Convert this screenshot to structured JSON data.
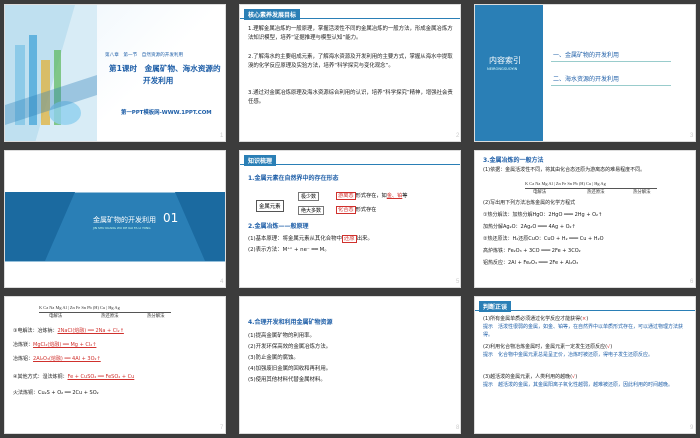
{
  "slides": [
    {
      "page": "1",
      "chapter": "第八章　第一节　自然资源的开发利用",
      "title_line1": "第1课时　金属矿物、海水资源的",
      "title_line2": "开发利用",
      "website": "第一PPT模板网-WWW.1PPT.COM"
    },
    {
      "page": "2",
      "tag": "核心素养发展目标",
      "goal1": "1.理解金属冶炼的一般原理，掌握活泼性不同的金属冶炼的一般方法，形成金属冶炼方法知识模型，培养“证据推理与模型认知”能力。",
      "goal2": "2.了解海水的主要组成元素，了解海水资源及开发利用的主要方式，掌握从海水中提取溴的化学反应原理及实验方法，培养“科学探究与变化观念”。",
      "goal3": "3.通过对金属冶炼原理及海水资源综合利用的认识，培养“科学探究”精神，增强社会责任感。"
    },
    {
      "page": "3",
      "index_title": "内容索引",
      "index_sub": "NEIRONGSUOYIN",
      "item1": "一、金属矿物的开发利用",
      "item2": "二、海水资源的开发利用"
    },
    {
      "page": "4",
      "section_cn": "金属矿物的开发利用",
      "section_en": "JIN SHU KUANG WU DE KAI FA LI YONG",
      "section_num": "01"
    },
    {
      "page": "5",
      "tag": "知识梳理",
      "h1": "1.金属元素在自然界中的存在形态",
      "node_center": "金属元素",
      "node_a": "极少数",
      "node_b": "绝大多数",
      "state_free": "游离态",
      "free_suffix": "形式存在，如",
      "examples": "金、铂",
      "eq_suffix": "等",
      "state_combined": "化合态",
      "combined_suffix": "形式存在",
      "h2": "2.金属冶炼——般原理",
      "p1": "(1)基本原理：将金属元素从其化合物中",
      "p1_key": "还原",
      "p1_tail": "出来。",
      "p2": "(2)表示方法：M⁺ⁿ + ne⁻ ══ M。"
    },
    {
      "page": "6",
      "h": "3.金属冶炼的一般方法",
      "l1": "(1)依据：金属活泼性不同，将其由化合态还原为游离态的难易程度不同。",
      "series": "K Ca Na Mg Al | Zn Fe Sn Pb (H) Cu | Hg Ag",
      "m1": "电解法",
      "m2": "热还原法",
      "m3": "热分解法",
      "l2": "(2)写出用下列方法冶炼金属的化学方程式",
      "l3": "①热分解法：加热分解HgO：2HgO ═══ 2Hg + O₂↑",
      "l4": "加热分解Ag₂O：2Ag₂O ═══ 4Ag + O₂↑",
      "l5": "②热还原法：H₂还原CuO：CuO + H₂ ═══ Cu + H₂O",
      "l6": "高炉炼铁：Fe₂O₃ + 3CO ═══ 2Fe + 3CO₂",
      "l7": "铝热反应：2Al + Fe₂O₃ ═══ 2Fe + Al₂O₃"
    },
    {
      "page": "7",
      "series": "K Ca Na Mg Al | Zn Fe Sn Pb (H) Cu | Hg Ag",
      "m1": "电解法",
      "m2": "热还原法",
      "m3": "热分解法",
      "l1": "③电解法：冶炼钠：",
      "r1": "2NaCl(熔融) ══ 2Na + Cl₂↑",
      "l2": "冶炼镁：",
      "r2": "MgCl₂(熔融) ══ Mg + Cl₂↑",
      "l3": "冶炼铝：",
      "r3": "2Al₂O₃(熔融) ══ 4Al + 3O₂↑",
      "l4": "④其他方式：湿法炼铜：",
      "r4": "Fe + CuSO₄ ══ FeSO₄ + Cu",
      "l5": "火法炼铜：Cu₂S + O₂ ══ 2Cu + SO₂"
    },
    {
      "page": "8",
      "h": "4.合理开发和利用金属矿物资源",
      "i1": "(1)提高金属矿物的利用率。",
      "i2": "(2)开发环保高效的金属冶炼方法。",
      "i3": "(3)防止金属的腐蚀。",
      "i4": "(4)加强废旧金属的回收和再利用。",
      "i5": "(5)使用其他材料代替金属材料。"
    },
    {
      "page": "9",
      "tag": "判断正误",
      "q1": "(1)所有金属单质必须通过化学反应才能获得(",
      "a1": "×",
      "t1": "提示　活泼性很弱的金属，如金、铂等，在自然界中以单质形式存在，可以通过物理方法获得。",
      "q2": "(2)利用化合物冶炼金属时，金属元素一定发生还原反应(",
      "a2": "√",
      "t2": "提示　化合物中金属元素总是呈正价，冶炼时被还原，得电子发生还原反应。",
      "q3": "(3)越活泼的金属元素，人类利用的越晚(",
      "a3": "√",
      "t3": "提示　越活泼的金属，其金属阳离子氧化性越弱，越难被还原，因此利用的时间越晚。"
    }
  ]
}
